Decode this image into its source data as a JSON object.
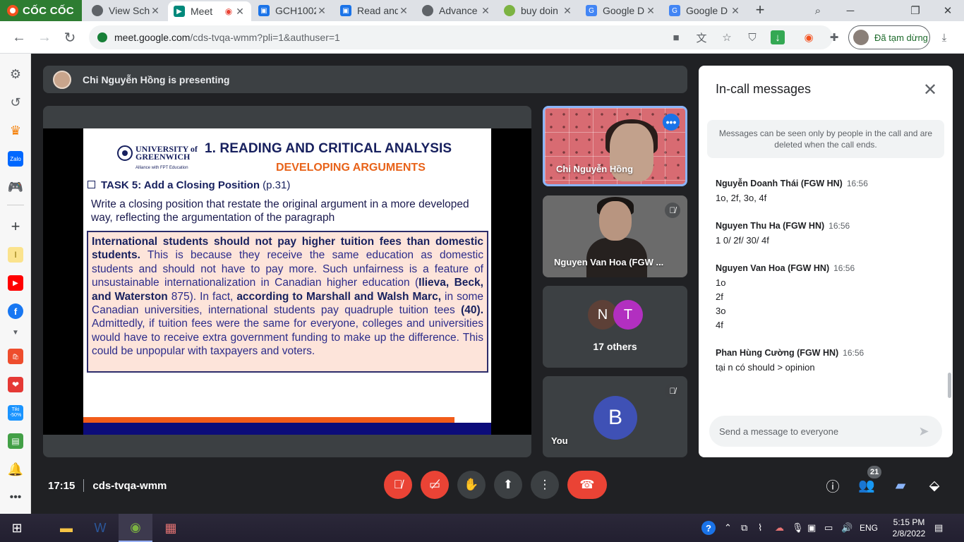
{
  "browser": {
    "brand": "CỐC CỐC",
    "tabs": [
      {
        "title": "View Sch",
        "color": "#5f6368"
      },
      {
        "title": "Meet",
        "color": "#00897b"
      },
      {
        "title": "GCH1002",
        "color": "#1a73e8"
      },
      {
        "title": "Read and",
        "color": "#1a73e8"
      },
      {
        "title": "Advance",
        "color": "#5f6368"
      },
      {
        "title": "buy doin",
        "color": "#7cb342"
      },
      {
        "title": "Google D",
        "color": "#4285f4"
      },
      {
        "title": "Google D",
        "color": "#4285f4"
      }
    ],
    "url_host": "meet.google.com",
    "url_path": "/cds-tvqa-wmm?pli=1&authuser=1",
    "pause_label": "Đã tạm dừng"
  },
  "meet": {
    "presenting_banner": "Chi Nguyễn Hồng is presenting",
    "slide": {
      "logo_line1": "UNIVERSITY of",
      "logo_line2": "GREENWICH",
      "alliance": "Alliance with FPT Education",
      "title": "1. READING AND CRITICAL ANALYSIS",
      "subtitle": "DEVELOPING ARGUMENTS",
      "task": "TASK 5: Add a Closing Position",
      "task_page": "(p.31)",
      "instruction": "Write a closing position that restate the original argument in a more developed way, reflecting the argumentation of the paragraph",
      "para_1_bold": "International students should not pay higher tuition fees than domestic students.",
      "para_2": " This is because they receive the same education as domestic students and should not have to pay more. Such unfairness is a feature of unsustainable internationalization in Canadian higher education (",
      "para_3_bold": "Ilieva, Beck, and Waterston",
      "para_4": " 875). In fact, ",
      "para_5_bold": "according to Marshall and Walsh Marc,",
      "para_6": " in some Canadian universities, international students pay quadruple tuition tees ",
      "para_7_bold": "(40).",
      "para_8": " Admittedly, if tuition fees were the same for everyone, colleges and universities would have to receive extra government funding to make up the difference. This could be unpopular with taxpayers and voters."
    },
    "tiles": {
      "presenter": "Chi Nguyễn Hồng",
      "participant2": "Nguyen Van Hoa (FGW ...",
      "others_initials": [
        "N",
        "T"
      ],
      "others_label": "17 others",
      "you_initial": "B",
      "you_label": "You"
    },
    "chat": {
      "title": "In-call messages",
      "notice": "Messages can be seen only by people in the call and are deleted when the call ends.",
      "messages": [
        {
          "sender": "Nguyễn Doanh Thái (FGW HN)",
          "time": "16:56",
          "lines": [
            "1o, 2f, 3o, 4f"
          ]
        },
        {
          "sender": "Nguyen Thu Ha (FGW HN)",
          "time": "16:56",
          "lines": [
            "1 0/ 2f/ 30/ 4f"
          ]
        },
        {
          "sender": "Nguyen Van Hoa (FGW HN)",
          "time": "16:56",
          "lines": [
            "1o",
            "2f",
            "3o",
            "4f"
          ]
        },
        {
          "sender": "Phan Hùng Cường (FGW HN)",
          "time": "16:56",
          "lines": [
            "tại n có should > opinion"
          ]
        }
      ],
      "input_placeholder": "Send a message to everyone"
    },
    "bottom": {
      "time": "17:15",
      "meeting_code": "cds-tvqa-wmm",
      "participants_count": "21"
    }
  },
  "taskbar": {
    "lang": "ENG",
    "time": "5:15 PM",
    "date": "2/8/2022"
  },
  "colors": {
    "meet_bg": "#202124",
    "danger": "#ea4335",
    "accent": "#8ab4f8",
    "slide_navy": "#17205e",
    "slide_orange": "#e8631a"
  }
}
